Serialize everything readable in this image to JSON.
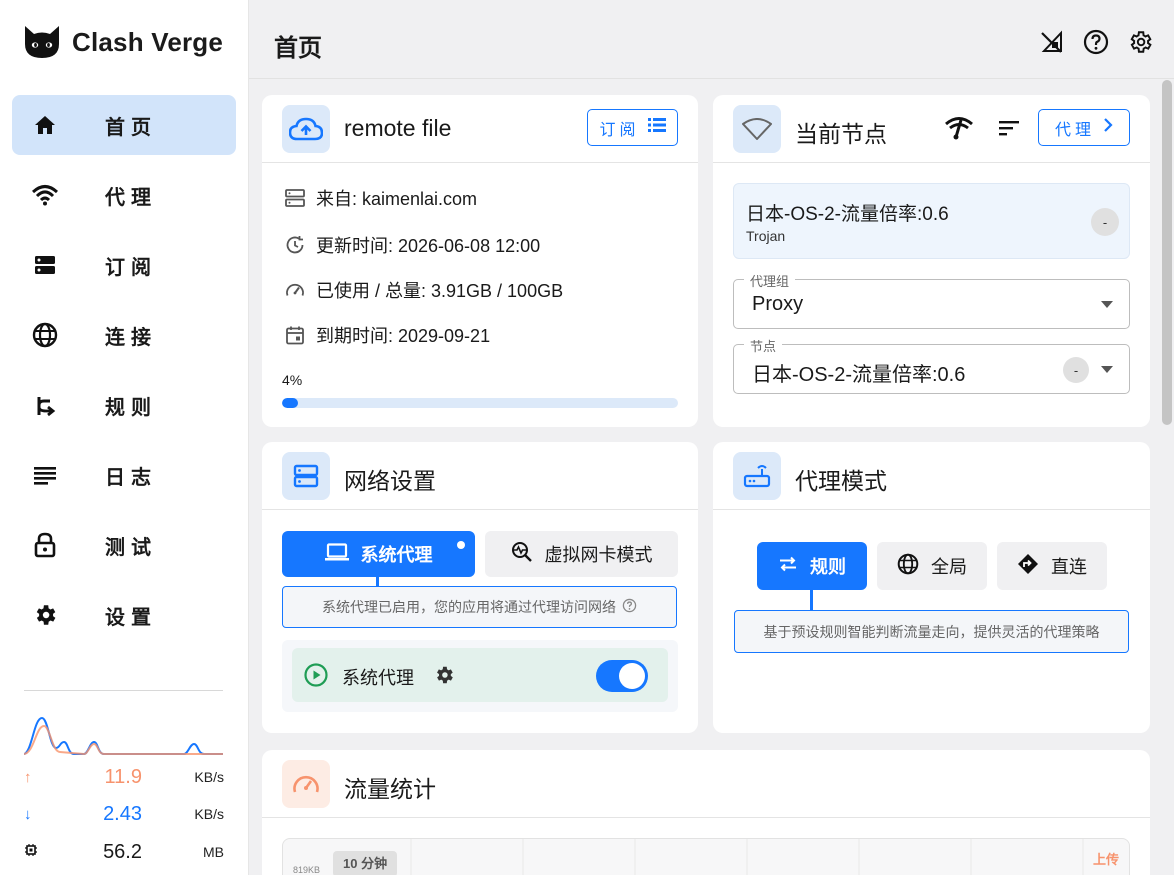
{
  "app": {
    "name": "Clash Verge"
  },
  "sidebar": {
    "items": [
      {
        "label": "首页",
        "icon": "home-icon",
        "active": true
      },
      {
        "label": "代理",
        "icon": "wifi-icon",
        "active": false
      },
      {
        "label": "订阅",
        "icon": "storage-icon",
        "active": false
      },
      {
        "label": "连接",
        "icon": "globe-icon",
        "active": false
      },
      {
        "label": "规则",
        "icon": "fork-icon",
        "active": false
      },
      {
        "label": "日志",
        "icon": "list-icon",
        "active": false
      },
      {
        "label": "测试",
        "icon": "lock-icon",
        "active": false
      },
      {
        "label": "设置",
        "icon": "gear-icon",
        "active": false
      }
    ],
    "traffic": {
      "upload": {
        "value": "11.9",
        "unit": "KB/s",
        "color": "#f7936d"
      },
      "download": {
        "value": "2.43",
        "unit": "KB/s",
        "color": "#1677ff"
      },
      "memory": {
        "value": "56.2",
        "unit": "MB"
      }
    }
  },
  "header": {
    "title": "首页"
  },
  "profile_card": {
    "title": "remote file",
    "subscribe_label": "订阅",
    "from": "来自: kaimenlai.com",
    "updated": "更新时间: 2026-06-08 12:00",
    "usage": "已使用 / 总量: 3.91GB / 100GB",
    "expire": "到期时间: 2029-09-21",
    "progress_label": "4%",
    "progress": 0.04
  },
  "current_node_card": {
    "title": "当前节点",
    "proxy_label": "代理",
    "node_name": "日本-OS-2-流量倍率:0.6",
    "node_type": "Trojan",
    "node_badge": "-",
    "group_label": "代理组",
    "group_value": "Proxy",
    "node_label": "节点",
    "node_value": "日本-OS-2-流量倍率:0.6",
    "node_value_badge": "-"
  },
  "network_card": {
    "title": "网络设置",
    "sys_proxy_btn": "系统代理",
    "tun_btn": "虚拟网卡模式",
    "tip": "系统代理已启用，您的应用将通过代理访问网络",
    "sys_proxy_row": "系统代理",
    "toggle_on": true
  },
  "mode_card": {
    "title": "代理模式",
    "rule_btn": "规则",
    "global_btn": "全局",
    "direct_btn": "直连",
    "tip": "基于预设规则智能判断流量走向，提供灵活的代理策略"
  },
  "traffic_card": {
    "title": "流量统计",
    "range_label": "10 分钟",
    "y_label": "819KB",
    "legend_upload": "上传"
  }
}
